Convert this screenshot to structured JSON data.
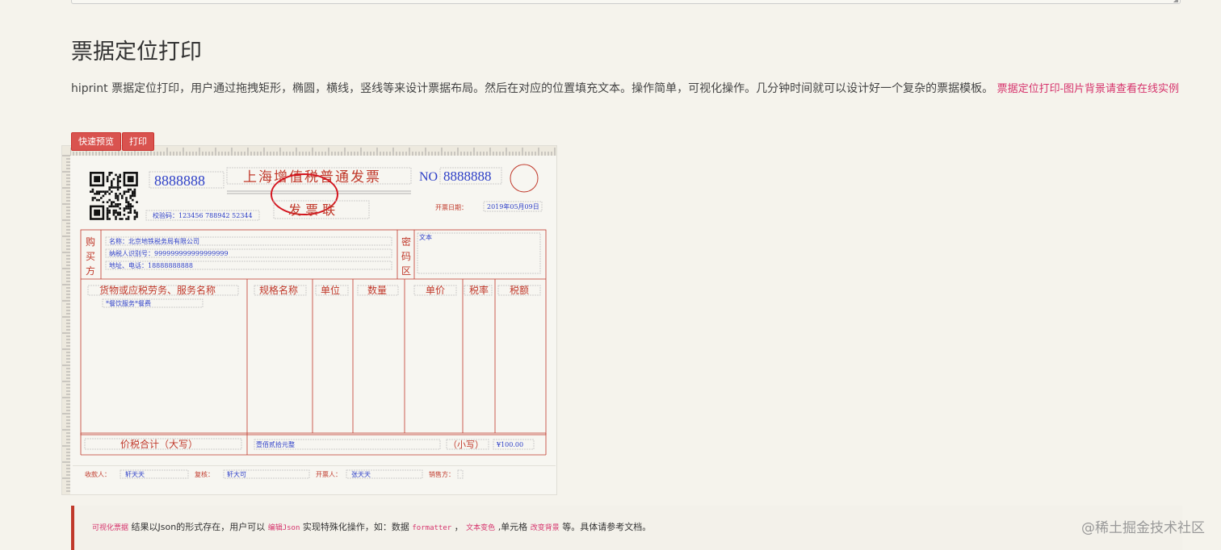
{
  "page": {
    "title": "票据定位打印",
    "description": "hiprint 票据定位打印，用户通过拖拽矩形，椭圆，横线，竖线等来设计票据布局。然后在对应的位置填充文本。操作简单，可视化操作。几分钟时间就可以设计好一个复杂的票据模板。",
    "description_link": "票据定位打印-图片背景请查看在线实例"
  },
  "toolbar": {
    "preview_label": "快速预览",
    "print_label": "打印"
  },
  "invoice": {
    "code_number": "8888888",
    "title": "上海增值税普通发票",
    "no_label": "NO",
    "no_number": "8888888",
    "copy_label": "发 票 联",
    "check_code": "校验码：123456 788942 52344",
    "date_label": "开票日期：",
    "date_value": "2019年05月09日",
    "buyer_label_1": "购",
    "buyer_label_2": "买",
    "buyer_label_3": "方",
    "buyer_name": "名称：北京地铁税务局有限公司",
    "buyer_taxid": "纳税人识别号：999999999999999999",
    "buyer_address": "地址、电话：18888888888",
    "cipher_label_1": "密",
    "cipher_label_2": "码",
    "cipher_label_3": "区",
    "cipher_text": "文本",
    "col_goods": "货物或应税劳务、服务名称",
    "col_spec": "规格名称",
    "col_unit": "单位",
    "col_qty": "数量",
    "col_price": "单价",
    "col_rate": "税率",
    "col_tax": "税额",
    "item_1": "*餐饮服务*餐费",
    "total_label": "价税合计（大写）",
    "total_upper": "壹佰贰拾元整",
    "small_label": "（小写）",
    "total_lower": "¥100.00",
    "payee_label": "收款人：",
    "payee_value": "轩天天",
    "review_label": "复核：",
    "review_value": "轩大可",
    "issuer_label": "开票人：",
    "issuer_value": "张天天",
    "seller_label": "销售方："
  },
  "note": {
    "tag1": "可视化票据",
    "text1": "结果以Json的形式存在，用户可以",
    "tag2": "编辑Json",
    "text2": "实现特殊化操作，如：数据",
    "tag3": "formatter",
    "text3": "，",
    "tag4": "文本变色",
    "text4": ",单元格",
    "tag5": "改变背景",
    "text5": "等。具体请参考文档。"
  },
  "watermark": "@稀土掘金技术社区",
  "colors": {
    "accent_red": "#d9534f",
    "invoice_red": "#c0392b",
    "invoice_blue": "#2c3ec7",
    "link_pink": "#d6336c"
  }
}
